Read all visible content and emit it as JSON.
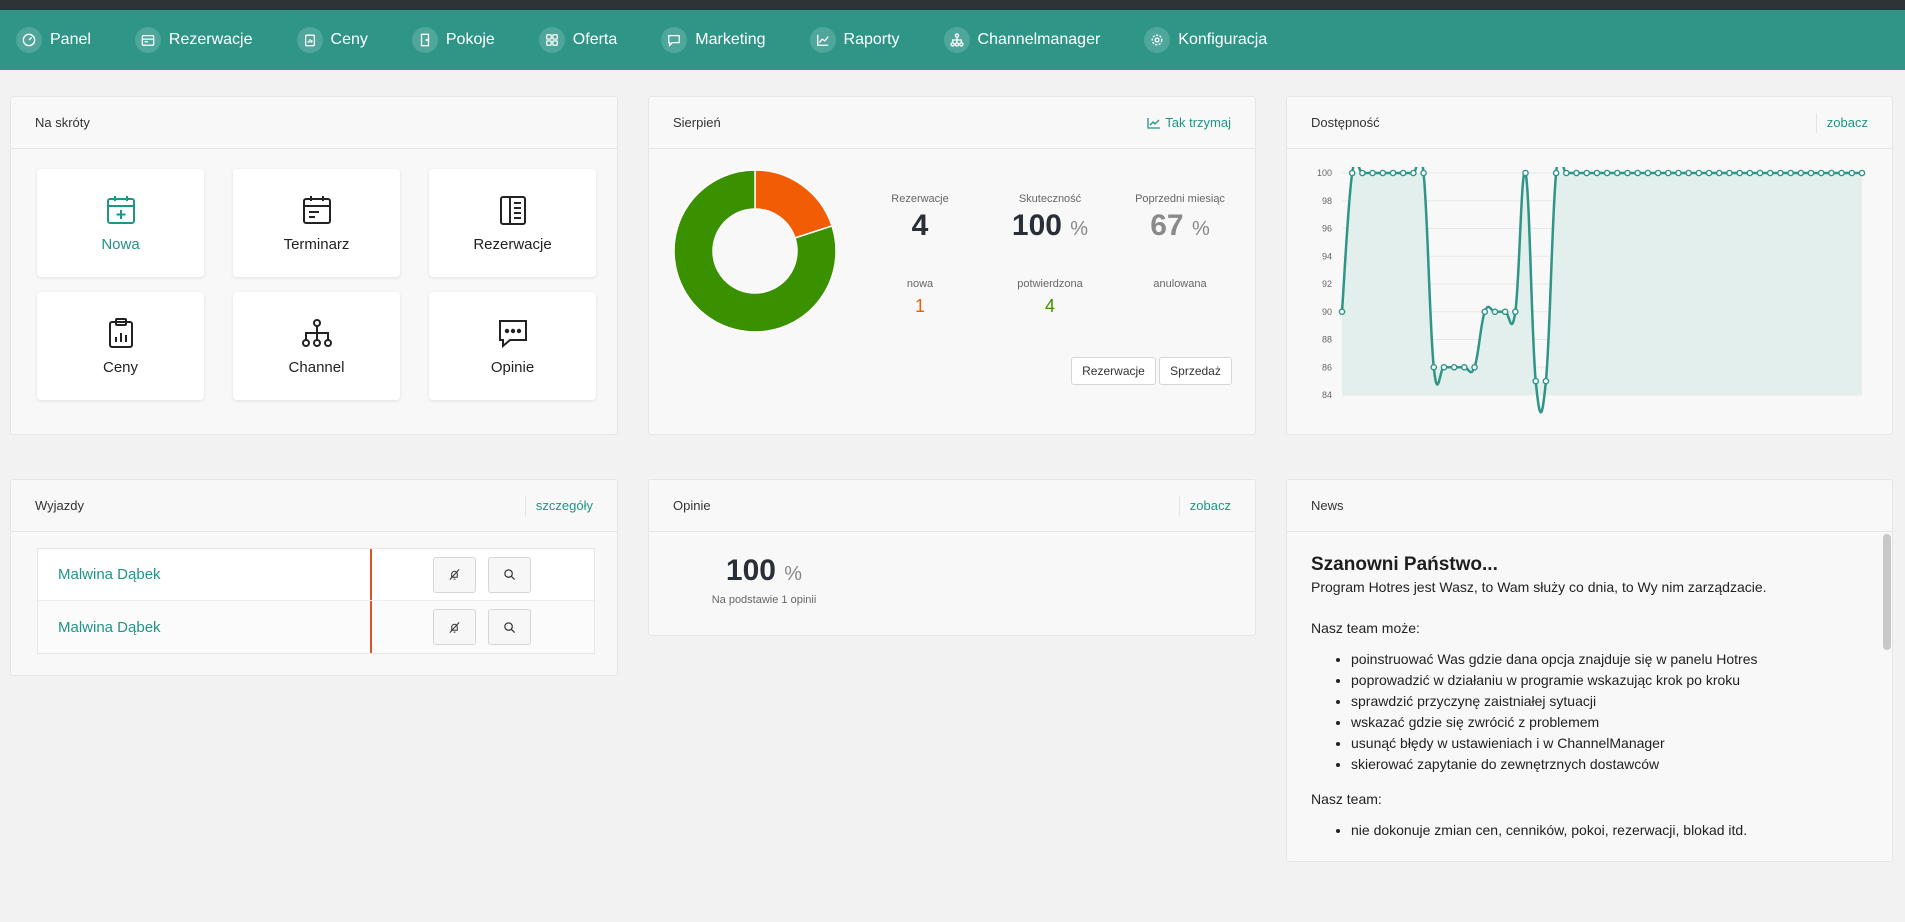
{
  "nav": {
    "items": [
      {
        "label": "Panel",
        "icon": "dashboard-icon"
      },
      {
        "label": "Rezerwacje",
        "icon": "calendar-card-icon"
      },
      {
        "label": "Ceny",
        "icon": "price-clipboard-icon"
      },
      {
        "label": "Pokoje",
        "icon": "door-icon"
      },
      {
        "label": "Oferta",
        "icon": "grid-icon"
      },
      {
        "label": "Marketing",
        "icon": "chat-icon"
      },
      {
        "label": "Raporty",
        "icon": "line-chart-icon"
      },
      {
        "label": "Channelmanager",
        "icon": "hierarchy-icon"
      },
      {
        "label": "Konfiguracja",
        "icon": "gear-icon"
      }
    ]
  },
  "shortcuts": {
    "title": "Na skróty",
    "tiles": [
      {
        "label": "Nowa",
        "icon": "calendar-plus-icon"
      },
      {
        "label": "Terminarz",
        "icon": "calendar-card-icon"
      },
      {
        "label": "Rezerwacje",
        "icon": "list-document-icon"
      },
      {
        "label": "Ceny",
        "icon": "clipboard-chart-icon"
      },
      {
        "label": "Channel",
        "icon": "hierarchy-icon"
      },
      {
        "label": "Opinie",
        "icon": "speech-bubble-icon"
      }
    ]
  },
  "month": {
    "title": "Sierpień",
    "link": "Tak trzymaj",
    "stats": {
      "reservations_label": "Rezerwacje",
      "reservations_value": "4",
      "efficiency_label": "Skuteczność",
      "efficiency_value": "100",
      "efficiency_unit": "%",
      "prev_label": "Poprzedni miesiąc",
      "prev_value": "67",
      "prev_unit": "%",
      "new_label": "nowa",
      "new_value": "1",
      "confirmed_label": "potwierdzona",
      "confirmed_value": "4",
      "cancelled_label": "anulowana"
    },
    "buttons": {
      "reservations": "Rezerwacje",
      "sales": "Sprzedaż"
    },
    "colors": {
      "new": "#f25c05",
      "confirmed": "#3a9100"
    }
  },
  "availability": {
    "title": "Dostępność",
    "link": "zobacz"
  },
  "chart_data": {
    "type": "area",
    "ylim": [
      84,
      100
    ],
    "yticks": [
      "100",
      "98",
      "96",
      "94",
      "92",
      "90",
      "88",
      "86",
      "84"
    ],
    "x": [
      1,
      2,
      3,
      4,
      5,
      6,
      7,
      8,
      9,
      10,
      11,
      12,
      13,
      14,
      15,
      16,
      17,
      18,
      19,
      20,
      21,
      22,
      23,
      24,
      25,
      26,
      27,
      28,
      29,
      30,
      31,
      32,
      33,
      34,
      35,
      36,
      37,
      38,
      39,
      40,
      41,
      42,
      43,
      44,
      45,
      46,
      47,
      48,
      49,
      50,
      51,
      52
    ],
    "values": [
      90,
      100,
      100,
      100,
      100,
      100,
      100,
      100,
      100,
      86,
      86,
      86,
      86,
      86,
      90,
      90,
      90,
      90,
      100,
      85,
      85,
      100,
      100,
      100,
      100,
      100,
      100,
      100,
      100,
      100,
      100,
      100,
      100,
      100,
      100,
      100,
      100,
      100,
      100,
      100,
      100,
      100,
      100,
      100,
      100,
      100,
      100,
      100,
      100,
      100,
      100,
      100
    ],
    "line_color": "#2e9587",
    "fill_color": "#e3efec",
    "grid": true
  },
  "donut": {
    "type": "pie",
    "slices": [
      {
        "label": "nowa",
        "value": 1,
        "color": "#f25c05"
      },
      {
        "label": "potwierdzona",
        "value": 4,
        "color": "#3a9100"
      }
    ]
  },
  "departures": {
    "title": "Wyjazdy",
    "link": "szczegóły",
    "rows": [
      {
        "name": "Malwina Dąbek"
      },
      {
        "name": "Malwina Dąbek"
      }
    ]
  },
  "reviews": {
    "title": "Opinie",
    "link": "zobacz",
    "value": "100",
    "unit": "%",
    "caption": "Na podstawie 1 opinii"
  },
  "news": {
    "title": "News",
    "heading": "Szanowni Państwo...",
    "intro": "Program Hotres jest Wasz, to Wam służy co dnia, to Wy nim zarządzacie.",
    "can_title": "Nasz team może:",
    "can_items": [
      "poinstruować Was gdzie dana opcja znajduje się w panelu Hotres",
      "poprowadzić w działaniu w programie wskazując krok po kroku",
      "sprawdzić przyczynę zaistniałej sytuacji",
      "wskazać gdzie się zwrócić z problemem",
      "usunąć błędy w ustawieniach i w ChannelManager",
      "skierować zapytanie do zewnętrznych dostawców"
    ],
    "cannot_title": "Nasz team:",
    "cannot_items": [
      "nie dokonuje zmian cen, cenników, pokoi, rezerwacji, blokad itd."
    ]
  }
}
